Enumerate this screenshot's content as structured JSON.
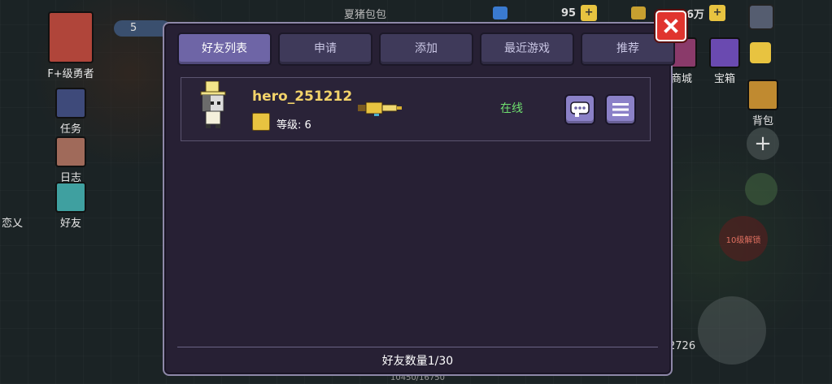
{
  "background": {
    "top_title": "夏猪包包",
    "currency_1": "95",
    "currency_2": "6万",
    "left_menu": [
      {
        "label": "F+级勇者",
        "icon": "hero-portrait-icon"
      },
      {
        "label": "任务",
        "icon": "quest-icon"
      },
      {
        "label": "日志",
        "icon": "log-icon"
      },
      {
        "label": "好友",
        "icon": "friend-icon"
      },
      {
        "label": "恋乂",
        "icon": "heart-icon"
      }
    ],
    "right_menu": [
      {
        "label": "商城",
        "icon": "shop-icon"
      },
      {
        "label": "宝箱",
        "icon": "chest-icon"
      },
      {
        "label": "背包",
        "icon": "backpack-icon"
      }
    ],
    "level_badge": "5",
    "unlock_label": "10级解锁",
    "score": "2726",
    "exp_text": "10450/16750"
  },
  "dialog": {
    "tabs": [
      {
        "label": "好友列表",
        "active": true
      },
      {
        "label": "申请",
        "active": false
      },
      {
        "label": "添加",
        "active": false
      },
      {
        "label": "最近游戏",
        "active": false
      },
      {
        "label": "推荐",
        "active": false
      }
    ],
    "friends": [
      {
        "name": "hero_251212",
        "level_label": "等级: 6",
        "status": "在线",
        "avatar": "knight-top-hat-avatar",
        "weapon": "golden-gun-icon"
      }
    ],
    "footer": "好友数量1/30"
  },
  "colors": {
    "panel_bg": "#272034",
    "tab_active": "#6e65a6",
    "tab_inactive": "#3f3a5a",
    "online": "#6fe06f",
    "name": "#f3d36a",
    "close": "#e0342e"
  }
}
